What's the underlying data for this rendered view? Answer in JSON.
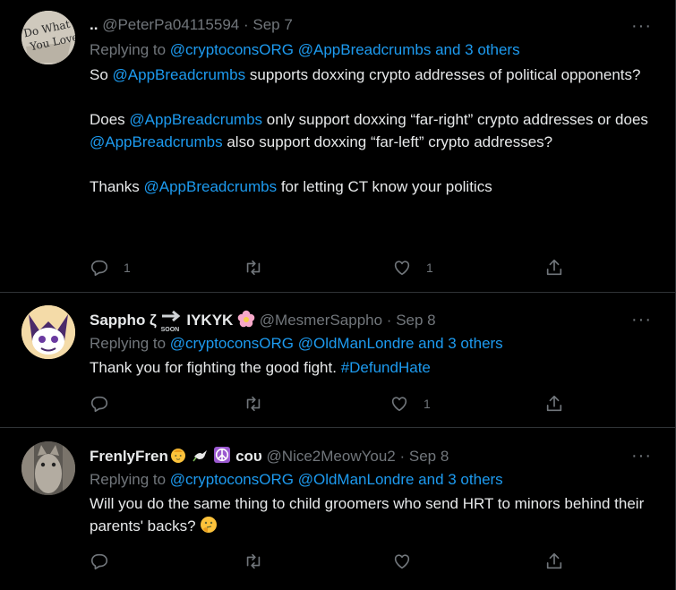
{
  "tweets": [
    {
      "name": "..",
      "handle": "@PeterPa04115594",
      "separator": "·",
      "date": "Sep 7",
      "reply_prefix": "Replying to",
      "reply_mention_1": "@cryptoconsORG",
      "reply_mention_2": "@AppBreadcrumbs",
      "reply_others": "and 3 others",
      "p1_a": "So ",
      "p1_link": "@AppBreadcrumbs",
      "p1_b": " supports doxxing crypto addresses of political opponents?",
      "p2_a": "Does ",
      "p2_link1": "@AppBreadcrumbs",
      "p2_b": " only support doxxing “far-right” crypto addresses or does ",
      "p2_link2": "@AppBreadcrumbs",
      "p2_c": " also support doxxing “far-left” crypto addresses?",
      "p3_a": "Thanks ",
      "p3_link": "@AppBreadcrumbs",
      "p3_b": " for letting CT know your politics",
      "reply_count": "1",
      "like_count": "1",
      "avatar_text_1": "Do What",
      "avatar_text_2": "You Love"
    },
    {
      "name_a": "Sappho ζ",
      "soon_label": "SOON",
      "name_b": "IYKYK",
      "handle": "@MesmerSappho",
      "separator": "·",
      "date": "Sep 8",
      "reply_prefix": "Replying to",
      "reply_mention_1": "@cryptoconsORG",
      "reply_mention_2": "@OldManLondre",
      "reply_others": "and 3 others",
      "text_a": "Thank you for fighting the good fight. ",
      "hashtag": "#DefundHate",
      "reply_count": "",
      "like_count": "1"
    },
    {
      "name_a": "FrenlyFren",
      "name_b": "ᴄᴏᴜ",
      "handle": "@Nice2MeowYou2",
      "separator": "·",
      "date": "Sep 8",
      "reply_prefix": "Replying to",
      "reply_mention_1": "@cryptoconsORG",
      "reply_mention_2": "@OldManLondre",
      "reply_others": "and 3 others",
      "text": "Will you do the same thing to child groomers who send HRT to minors behind their parents' backs?",
      "reply_count": "",
      "like_count": ""
    }
  ],
  "more_label": "···",
  "colors": {
    "background": "#000000",
    "link": "#1d9bf0",
    "muted": "#71767b",
    "text": "#e7e9ea",
    "divider": "#2f3336"
  },
  "icons": [
    "reply-icon",
    "retweet-icon",
    "like-icon",
    "share-icon",
    "more-icon",
    "flower-emoji",
    "baby-emoji",
    "dove-emoji",
    "peace-emoji",
    "thinking-emoji",
    "soon-arrow-emoji"
  ]
}
